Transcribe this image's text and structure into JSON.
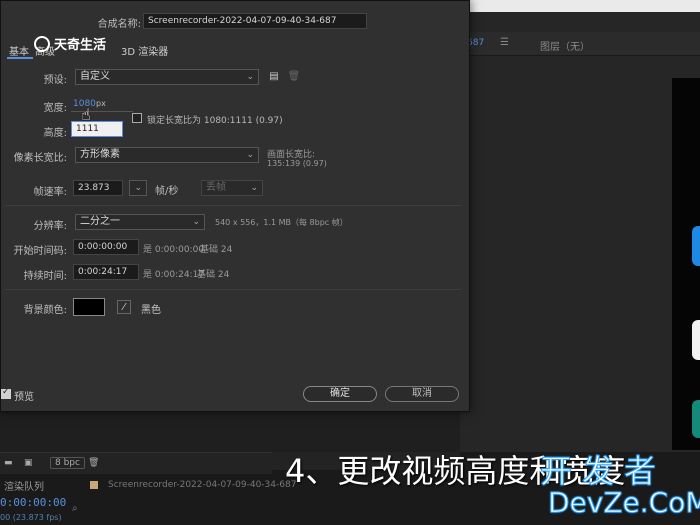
{
  "app": {
    "right_panel": {
      "active_tab": "687",
      "layer_label": "图层（无）"
    },
    "bottom": {
      "bpc": "8 bpc",
      "render_queue": "渲染队列",
      "timecode": "0:00:00:00",
      "fps": "00 (23.873 fps)",
      "comp_tab": "Screenrecorder-2022-04-07-09-40-34-687",
      "search_icon": "search-icon"
    }
  },
  "dialog": {
    "name_label": "合成名称:",
    "name_value": "Screenrecorder-2022-04-07-09-40-34-687",
    "tabs": [
      "基本",
      "高级",
      "3D 渲染器"
    ],
    "preset_label": "预设:",
    "preset_value": "自定义",
    "width_label": "宽度:",
    "width_value": "1080",
    "width_unit": "px",
    "lock_ratio_label": "锁定长宽比为 1080:1111 (0.97)",
    "height_label": "高度:",
    "height_value": "1111",
    "pixel_aspect_label": "像素长宽比:",
    "pixel_aspect_value": "方形像素",
    "frame_aspect_label": "画面长宽比:",
    "frame_aspect_value": "135:139 (0.97)",
    "framerate_label": "帧速率:",
    "framerate_value": "23.873",
    "framerate_unit": "帧/秒",
    "frame_drop_value": "丢帧",
    "resolution_label": "分辨率:",
    "resolution_value": "二分之一",
    "resolution_info": "540 x 556，1.1 MB（每 8bpc 帧）",
    "start_tc_label": "开始时间码:",
    "start_tc_value": "0:00:00:00",
    "start_tc_info": "是 0:00:00:00",
    "start_tc_base": "基础 24",
    "duration_label": "持续时间:",
    "duration_value": "0:00:24:17",
    "duration_info": "是 0:00:24:17",
    "duration_base": "基础 24",
    "bg_color_label": "背景颜色:",
    "bg_color_value": "#000000",
    "bg_color_name": "黑色",
    "preview_label": "预览",
    "ok_label": "确定",
    "cancel_label": "取消"
  },
  "overlay": {
    "logo_text": "天奇生活",
    "caption": "4、更改视频高度和宽度",
    "watermark_cn": "开发者",
    "watermark_en": "DevZe.CoM"
  }
}
